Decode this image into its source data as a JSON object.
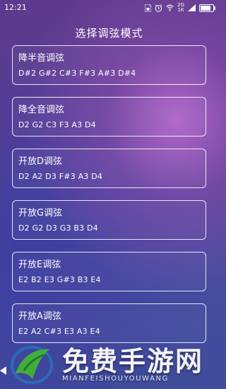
{
  "status_bar": {
    "time": "12:21",
    "icons": [
      "sim-card-icon",
      "alarm-icon",
      "wifi-icon",
      "signal-icon",
      "battery-icon"
    ],
    "network_top": "2G",
    "network_bottom": "1K",
    "battery_level": 0.85
  },
  "page": {
    "title": "选择调弦模式"
  },
  "modes": [
    {
      "name": "降半音调弦",
      "notes": "D#2  G#2  C#3  F#3  A#3  D#4"
    },
    {
      "name": "降全音调弦",
      "notes": "D2  G2  C3  F3  A3  D4"
    },
    {
      "name": "开放D调弦",
      "notes": "D2  A2  D3  F#3  A3  D4"
    },
    {
      "name": "开放G调弦",
      "notes": "D2  G2  D3  G3  B3  D4"
    },
    {
      "name": "开放E调弦",
      "notes": "E2  B2  E3  G#3  B3  E4"
    },
    {
      "name": "开放A调弦",
      "notes": "E2  A2  C#3  E3  A3  E4"
    }
  ],
  "watermark": {
    "main": "免费手游网",
    "sub": "MIANFEISHOUYOUWANG"
  },
  "colors": {
    "card_border": "#ffffff",
    "bg_top": "#5d3a8d",
    "bg_bottom": "#3f4d9b",
    "logo_green": "#3fae3b",
    "logo_blue": "#2a6fb8"
  }
}
